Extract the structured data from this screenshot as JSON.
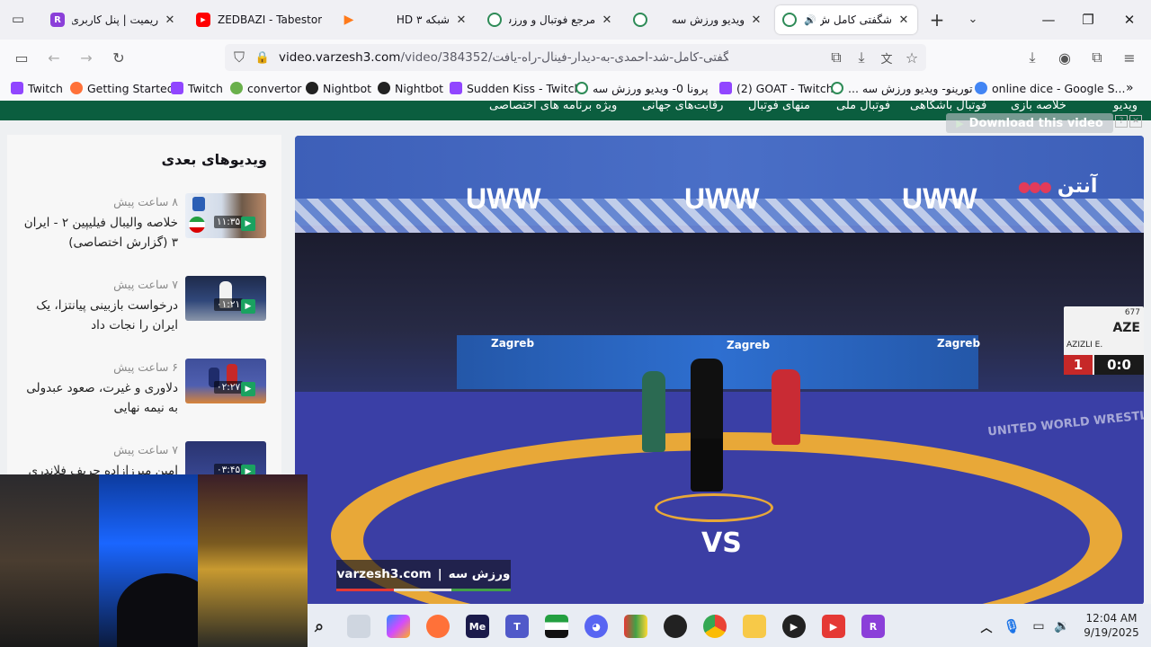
{
  "tabs": [
    {
      "title": "ریمیت | پنل کاربری",
      "favicon": "R",
      "color": "#8b3fd9"
    },
    {
      "title": "ZEDBAZI - Tabeston",
      "favicon": "▶",
      "color": "#ff0000"
    },
    {
      "title": "",
      "favicon": "▶",
      "color": "#ff7a1a"
    },
    {
      "title": "شبکه ۳ HD",
      "favicon": "",
      "color": "#999999"
    },
    {
      "title": "مرجع فوتبال و ورزش",
      "favicon": "",
      "color": "#2e8b57"
    },
    {
      "title": "ویدیو ورزش سه",
      "favicon": "",
      "color": "#2e8b57"
    },
    {
      "title": "شگفتی کامل ش",
      "favicon": "",
      "color": "#2e8b57"
    }
  ],
  "nav": {
    "url_domain": "video.varzesh3.com",
    "url_path": "/video/384352/شگفتی-کامل-شد-احمدی-به-دیدار-فینال-راه-یافت"
  },
  "bookmarks": [
    {
      "label": "Twitch",
      "color": "#9146ff"
    },
    {
      "label": "Getting Started",
      "color": "#ff7139"
    },
    {
      "label": "Twitch",
      "color": "#9146ff"
    },
    {
      "label": "convertor",
      "color": "#6ab04c"
    },
    {
      "label": "Nightbot",
      "color": "#222222"
    },
    {
      "label": "Nightbot",
      "color": "#222222"
    },
    {
      "label": "Sudden Kiss - Twitch",
      "color": "#9146ff"
    },
    {
      "label": "پرونا 0- ویدیو ورزش سه",
      "color": "#2e8b57"
    },
    {
      "label": "(2) GOAT - Twitch",
      "color": "#9146ff"
    },
    {
      "label": "تورینو- ویدیو ورزش سه ...",
      "color": "#2e8b57"
    },
    {
      "label": "online dice - Google S...",
      "color": "#4285f4"
    }
  ],
  "site_nav": [
    "ویدیو",
    "خلاصه بازی",
    "فوتبال باشگاهی",
    "فوتبال ملی",
    "منهای فوتبال",
    "رقابت‌های جهانی",
    "ویژه برنامه های اختصاصی"
  ],
  "download_label": "Download this video",
  "sidebar": {
    "title": "ویدیوهای بعدی",
    "items": [
      {
        "time": "۸ ساعت پیش",
        "title": "خلاصه والیبال فیلیپین ۲ - ایران ۳ (گزارش اختصاصی)",
        "duration": "۱۱:۳۵"
      },
      {
        "time": "۷ ساعت پیش",
        "title": "درخواست بازبینی پیانتزا، یک ایران را نجات داد",
        "duration": "۰۱:۲۱"
      },
      {
        "time": "۶ ساعت پیش",
        "title": "دلاوری و غیرت، صعود عبدولی به نیمه نهایی",
        "duration": "۰۲:۲۷"
      },
      {
        "time": "۷ ساعت پیش",
        "title": "امین میرزازاده حریف فلاندری را",
        "duration": "۰۳:۴۵"
      }
    ]
  },
  "player": {
    "watermark_site": "varzesh3.com",
    "watermark_brand": "ورزش سه",
    "channel_logo": "آنتن",
    "banner": "UWW",
    "vs": "VS",
    "score_country": "AZE",
    "score_name": "AZIZLI E.",
    "score_period": "1",
    "score_points": "0:0",
    "score_small": "677",
    "sponsor": "Zagreb",
    "mat_text": "UNITED WORLD WRESTLING"
  },
  "taskbar": {
    "time": "12:04 AM",
    "date": "9/19/2025"
  }
}
